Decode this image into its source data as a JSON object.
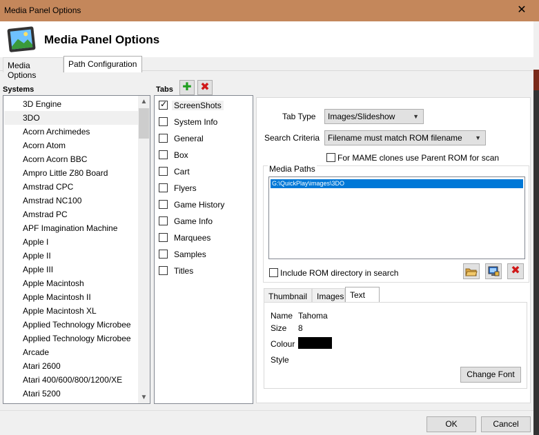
{
  "window": {
    "title": "Media Panel Options",
    "close_glyph": "✕"
  },
  "header": {
    "title": "Media Panel Options",
    "icon": "picture-icon"
  },
  "outer_tabs": [
    {
      "label": "Media Options",
      "active": false
    },
    {
      "label": "Path Configuration",
      "active": true
    }
  ],
  "systems": {
    "label": "Systems",
    "items": [
      "3D Engine",
      "3DO",
      "Acorn Archimedes",
      "Acorn Atom",
      "Acorn Acorn BBC",
      "Ampro Little Z80 Board",
      "Amstrad CPC",
      "Amstrad NC100",
      "Amstrad PC",
      "APF Imagination Machine",
      "Apple I",
      "Apple II",
      "Apple III",
      "Apple Macintosh",
      "Apple Macintosh II",
      "Apple Macintosh XL",
      "Applied Technology Microbee",
      "Applied Technology Microbee",
      "Arcade",
      "Atari 2600",
      "Atari 400/600/800/1200/XE",
      "Atari 5200"
    ],
    "selected_index": 1
  },
  "tabs": {
    "label": "Tabs",
    "add_glyph": "✚",
    "remove_glyph": "✖",
    "items": [
      {
        "label": "ScreenShots",
        "checked": true
      },
      {
        "label": "System Info",
        "checked": false
      },
      {
        "label": "General",
        "checked": false
      },
      {
        "label": "Box",
        "checked": false
      },
      {
        "label": "Cart",
        "checked": false
      },
      {
        "label": "Flyers",
        "checked": false
      },
      {
        "label": "Game History",
        "checked": false
      },
      {
        "label": "Game Info",
        "checked": false
      },
      {
        "label": "Marquees",
        "checked": false
      },
      {
        "label": "Samples",
        "checked": false
      },
      {
        "label": "Titles",
        "checked": false
      }
    ],
    "selected_index": 0
  },
  "config": {
    "tab_type_label": "Tab Type",
    "tab_type_value": "Images/Slideshow",
    "search_criteria_label": "Search Criteria",
    "search_criteria_value": "Filename must match ROM filename",
    "mame_clones_label": "For MAME clones use Parent ROM for scan",
    "mame_clones_checked": false,
    "media_paths_label": "Media Paths",
    "media_paths": [
      "G:\\QuickPlay\\images\\3DO"
    ],
    "include_rom_label": "Include ROM directory in search",
    "include_rom_checked": false
  },
  "inner_tabs": [
    {
      "label": "Thumbnail",
      "active": false
    },
    {
      "label": "Images",
      "active": false
    },
    {
      "label": "Text",
      "active": true
    }
  ],
  "text_settings": {
    "name_label": "Name",
    "name_value": "Tahoma",
    "size_label": "Size",
    "size_value": "8",
    "colour_label": "Colour",
    "colour_value": "#000000",
    "style_label": "Style",
    "change_font_label": "Change Font"
  },
  "footer": {
    "ok_label": "OK",
    "cancel_label": "Cancel"
  },
  "colors": {
    "titlebar": "#c4875b",
    "selection": "#0078d7",
    "add": "#1e9e1e",
    "remove": "#d01818"
  }
}
